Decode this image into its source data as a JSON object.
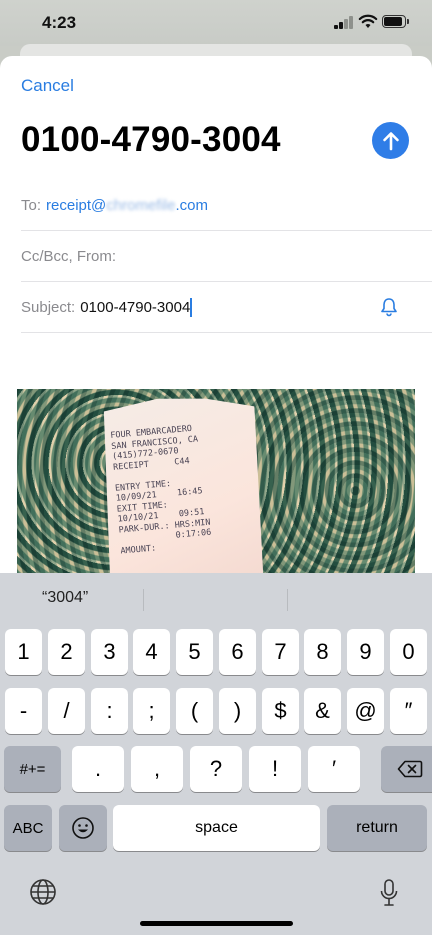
{
  "status": {
    "time": "4:23"
  },
  "compose": {
    "cancel_label": "Cancel",
    "title": "0100-4790-3004",
    "to_label": "To:",
    "to_prefix": "receipt@",
    "to_blurred": "chromefile",
    "to_suffix": ".com",
    "cc_label": "Cc/Bcc, From:",
    "subject_label": "Subject:",
    "subject_value": "0100-4790-3004"
  },
  "attachment": {
    "receipt_text": "FOUR EMBARCADERO\nSAN FRANCISCO, CA\n(415)772-0670\nRECEIPT     C44\n\nENTRY TIME:\n10/09/21    16:45\nEXIT TIME:\n10/10/21    09:51\nPARK-DUR.: HRS:MIN\n           0:17:06\nAMOUNT:"
  },
  "keyboard": {
    "suggestion": "“3004”",
    "row1": [
      "1",
      "2",
      "3",
      "4",
      "5",
      "6",
      "7",
      "8",
      "9",
      "0"
    ],
    "row2": [
      "-",
      "/",
      ":",
      ";",
      "(",
      ")",
      "$",
      "&",
      "@",
      "″"
    ],
    "row3": [
      ".",
      ",",
      "?",
      "!",
      "′"
    ],
    "symbols_label": "#+=",
    "abc_label": "ABC",
    "space_label": "space",
    "return_label": "return"
  },
  "icons": {
    "send": "arrow-up-icon",
    "bell": "bell-icon",
    "delete": "delete-backspace-icon",
    "emoji": "emoji-icon",
    "globe": "globe-icon",
    "mic": "microphone-icon"
  },
  "colors": {
    "accent": "#2a7de1",
    "send_button": "#2f7de7"
  }
}
